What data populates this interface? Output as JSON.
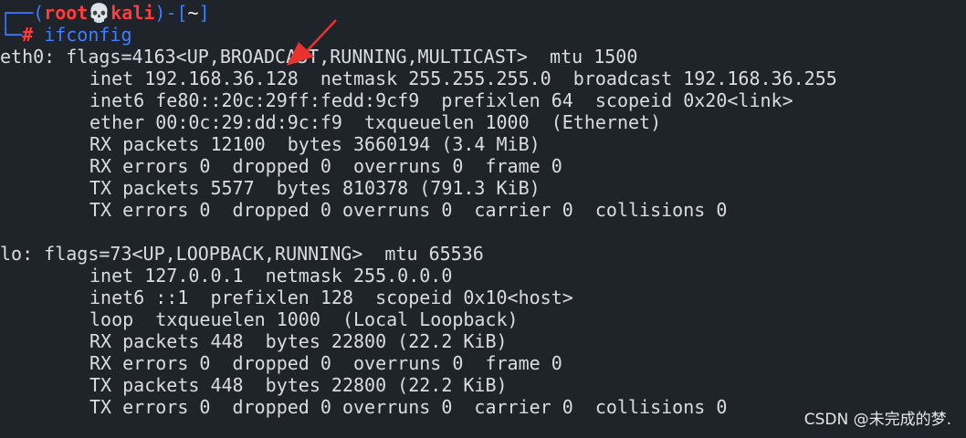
{
  "prompt": {
    "box_open": "┌──(",
    "user": "root💀kali",
    "mid": ")-[",
    "cwd": "~",
    "box_close": "]",
    "corner": "└─",
    "hash": "#",
    "command": "ifconfig"
  },
  "output": {
    "eth0": [
      "eth0: flags=4163<UP,BROADCAST,RUNNING,MULTICAST>  mtu 1500",
      "inet 192.168.36.128  netmask 255.255.255.0  broadcast 192.168.36.255",
      "inet6 fe80::20c:29ff:fedd:9cf9  prefixlen 64  scopeid 0x20<link>",
      "ether 00:0c:29:dd:9c:f9  txqueuelen 1000  (Ethernet)",
      "RX packets 12100  bytes 3660194 (3.4 MiB)",
      "RX errors 0  dropped 0  overruns 0  frame 0",
      "TX packets 5577  bytes 810378 (791.3 KiB)",
      "TX errors 0  dropped 0 overruns 0  carrier 0  collisions 0"
    ],
    "lo": [
      "lo: flags=73<UP,LOOPBACK,RUNNING>  mtu 65536",
      "inet 127.0.0.1  netmask 255.0.0.0",
      "inet6 ::1  prefixlen 128  scopeid 0x10<host>",
      "loop  txqueuelen 1000  (Local Loopback)",
      "RX packets 448  bytes 22800 (22.2 KiB)",
      "RX errors 0  dropped 0  overruns 0  frame 0",
      "TX packets 448  bytes 22800 (22.2 KiB)",
      "TX errors 0  dropped 0 overruns 0  carrier 0  collisions 0"
    ]
  },
  "watermark": "CSDN @未完成的梦.",
  "colors": {
    "background": "#1f242b",
    "prompt_frame": "#3f7dff",
    "prompt_user": "#ff3b3b",
    "annotation_arrow": "#e8322b"
  }
}
